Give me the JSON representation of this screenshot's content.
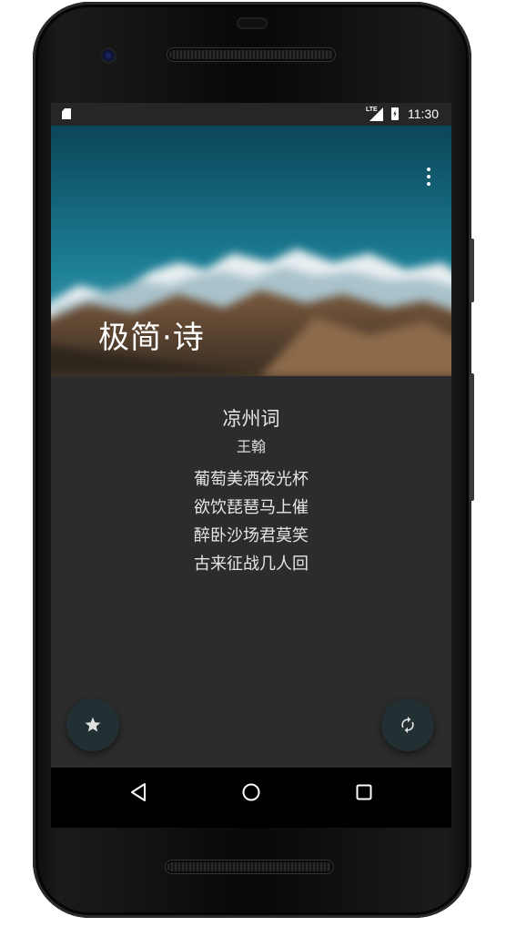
{
  "status_bar": {
    "network": "LTE",
    "time": "11:30"
  },
  "header": {
    "app_title": "极简·诗"
  },
  "poem": {
    "title": "凉州词",
    "author": "王翰",
    "lines": [
      "葡萄美酒夜光杯",
      "欲饮琵琶马上催",
      "醉卧沙场君莫笑",
      "古来征战几人回"
    ]
  },
  "icons": {
    "overflow": "more-vert-icon",
    "favorite": "star-icon",
    "refresh": "refresh-icon",
    "nav_back": "triangle-back-icon",
    "nav_home": "circle-home-icon",
    "nav_recent": "square-recents-icon"
  },
  "colors": {
    "content_background": "#2c2c2c",
    "fab_background": "#233033",
    "status_bar": "#262626",
    "text": "#e6e6e6"
  }
}
